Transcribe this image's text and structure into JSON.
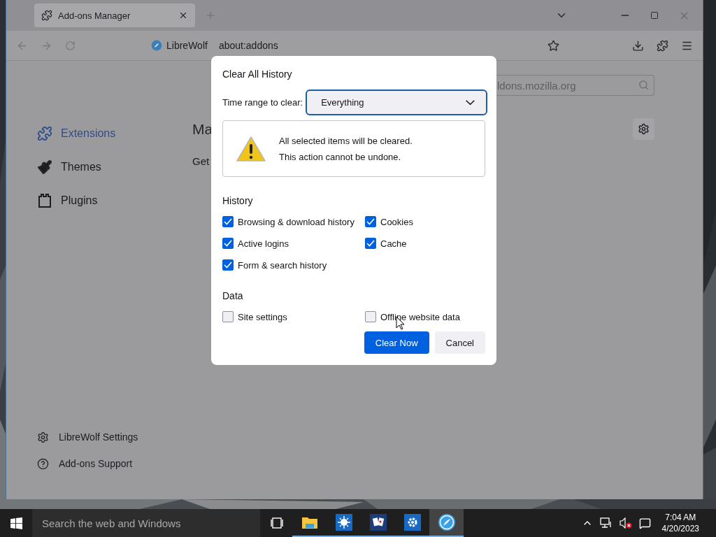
{
  "browser": {
    "tabs": [
      {
        "label": "Add-ons Manager",
        "selected": true
      }
    ],
    "url_bar": {
      "identity": "LibreWolf",
      "url": "about:addons"
    }
  },
  "sidebar": {
    "items": [
      {
        "label": "Extensions",
        "selected": true,
        "kind": "extensions"
      },
      {
        "label": "Themes",
        "selected": false,
        "kind": "themes"
      },
      {
        "label": "Plugins",
        "selected": false,
        "kind": "plugins"
      }
    ],
    "footer": [
      {
        "label": "LibreWolf Settings",
        "kind": "settings"
      },
      {
        "label": "Add-ons Support",
        "kind": "help"
      }
    ]
  },
  "main": {
    "search": {
      "placeholder": "ldons.mozilla.org"
    },
    "heading": "Ma",
    "text": "Get"
  },
  "dialog": {
    "title": "Clear All History",
    "time_range": {
      "label": "Time range to clear:",
      "value": "Everything"
    },
    "warning": [
      "All selected items will be cleared.",
      "This action cannot be undone."
    ],
    "sections": [
      {
        "heading": "History",
        "options": [
          {
            "label": "Browsing & download history",
            "checked": true
          },
          {
            "label": "Cookies",
            "checked": true
          },
          {
            "label": "Active logins",
            "checked": true
          },
          {
            "label": "Cache",
            "checked": true
          },
          {
            "label": "Form & search history",
            "checked": true
          }
        ]
      },
      {
        "heading": "Data",
        "options": [
          {
            "label": "Site settings",
            "checked": false
          },
          {
            "label": "Offline website data",
            "checked": false
          }
        ]
      }
    ],
    "buttons": [
      {
        "label": "Clear Now",
        "kind": "primary"
      },
      {
        "label": "Cancel",
        "kind": "secondary"
      }
    ]
  },
  "taskbar": {
    "search": {
      "placeholder": "Search the web and Windows"
    },
    "apps": [
      {
        "kind": "explorer",
        "selected": false
      },
      {
        "kind": "sun",
        "selected": false
      },
      {
        "kind": "cards",
        "selected": false
      },
      {
        "kind": "settings",
        "selected": false
      },
      {
        "kind": "browser",
        "selected": true
      }
    ],
    "clock": {
      "time": "7:04 AM",
      "date": "4/20/2023"
    }
  }
}
